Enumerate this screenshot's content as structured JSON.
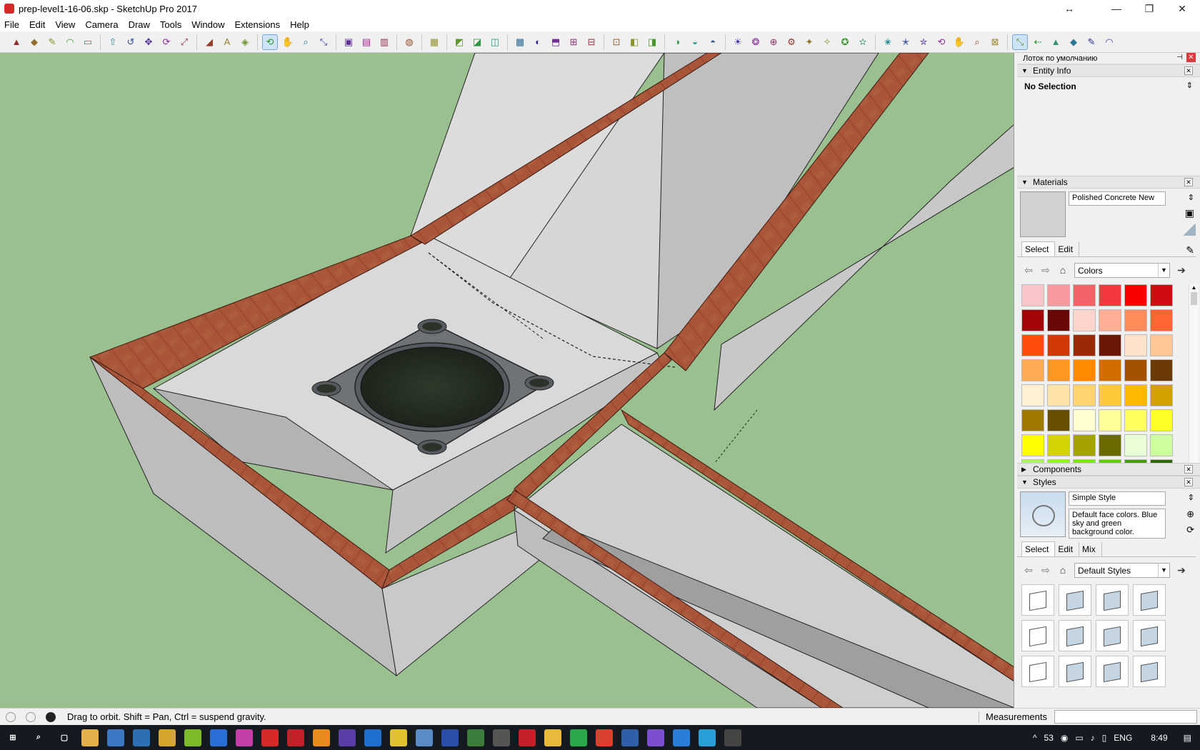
{
  "window": {
    "title": "prep-level1-16-06.skp - SketchUp Pro 2017",
    "controls": [
      "↔",
      "—",
      "❐",
      "✕"
    ]
  },
  "menu": [
    "File",
    "Edit",
    "View",
    "Camera",
    "Draw",
    "Tools",
    "Window",
    "Extensions",
    "Help"
  ],
  "toolbar": {
    "groups": [
      [
        "select-tool",
        "eraser-tool",
        "pencil-tool",
        "arc-tool",
        "rectangle-tool"
      ],
      [
        "push-pull-tool",
        "follow-me-tool",
        "move-tool",
        "rotate-tool",
        "scale-tool"
      ],
      [
        "tape-measure-tool",
        "text-tool",
        "paint-bucket-tool"
      ],
      [
        "orbit-tool",
        "pan-tool",
        "zoom-tool",
        "zoom-extents-tool"
      ],
      [
        "warehouse-tool",
        "share-component-tool",
        "share-model-tool"
      ],
      [
        "extension-warehouse-tool"
      ],
      [
        "layout-tool"
      ],
      [
        "sandbox-1-tool",
        "sandbox-2-tool",
        "sandbox-3-tool"
      ],
      [
        "section-plane-tool",
        "section-display-tool",
        "section-fill-tool",
        "section-cut-tool",
        "position-camera-tool"
      ],
      [
        "xray-tool",
        "back-edges-tool",
        "wireframe-tool"
      ],
      [
        "hidden-line-tool",
        "shaded-tool",
        "textured-tool"
      ],
      [
        "walk-tool",
        "look-around-tool",
        "shadows-tool",
        "fog-tool",
        "match-photo-tool",
        "sun-tool",
        "globe-tool",
        "settings-tool"
      ],
      [
        "export-1-tool",
        "export-2-tool",
        "export-3-tool",
        "export-4-tool",
        "export-5-tool",
        "export-6-tool",
        "export-7-tool"
      ],
      [
        "orbit-2-tool",
        "pan-2-tool",
        "zoom-2-tool",
        "zoom-window-tool",
        "zoom-extents-2-tool",
        "previous-view-tool"
      ]
    ]
  },
  "tray": {
    "title": "Лоток по умолчанию",
    "entity_info": {
      "header": "Entity Info",
      "selection": "No Selection"
    },
    "materials": {
      "header": "Materials",
      "name": "Polished Concrete New",
      "tabs": [
        "Select",
        "Edit"
      ],
      "library": "Colors",
      "swatches": [
        "#f8c6c9",
        "#f79a9f",
        "#f36266",
        "#f43840",
        "#fc0000",
        "#d00b11",
        "#a10508",
        "#680608",
        "#ffd4cc",
        "#ffad94",
        "#ff8c5a",
        "#ff6433",
        "#ff4d0f",
        "#d23a05",
        "#9a2a05",
        "#6a1a04",
        "#ffe2cc",
        "#ffc797",
        "#ffaa55",
        "#ff9722",
        "#ff8a00",
        "#d26e00",
        "#a35300",
        "#6c3a07",
        "#fff2d3",
        "#ffe2a8",
        "#ffd470",
        "#ffc838",
        "#ffba00",
        "#d4a000",
        "#a07a00",
        "#684f00",
        "#ffffd2",
        "#ffff9b",
        "#ffff60",
        "#ffff25",
        "#ffff00",
        "#d4d200",
        "#a3a200",
        "#6b6a00",
        "#eaffd6",
        "#ccff9e",
        "#a6ff4f",
        "#8cff1e",
        "#70f000",
        "#5bd000",
        "#419d00",
        "#2a6a00"
      ]
    },
    "components": {
      "header": "Components"
    },
    "styles": {
      "header": "Styles",
      "name": "Simple Style",
      "description": "Default face colors. Blue sky and green background color.",
      "tabs": [
        "Select",
        "Edit",
        "Mix"
      ],
      "library": "Default Styles"
    }
  },
  "status": {
    "hint": "Drag to orbit. Shift = Pan, Ctrl = suspend gravity.",
    "measurements_label": "Measurements",
    "measurements_value": ""
  },
  "taskbar": {
    "apps": [
      "start",
      "search",
      "task-view",
      "explorer",
      "app-gear",
      "app-monitor",
      "app-hand",
      "app-green",
      "photoshop",
      "xd",
      "sketchup",
      "sketchup-2",
      "blender",
      "app-circle",
      "app-circle-2",
      "app-tree",
      "app-virus",
      "app-shield",
      "app-chart",
      "app-ball",
      "filezilla",
      "chrome",
      "app-chat",
      "app-mail",
      "app-news",
      "viber",
      "app-windows",
      "app-box",
      "app-zip"
    ],
    "tray": {
      "up_arrow": "^",
      "num": "53",
      "lang": "ENG",
      "time": "8:49"
    }
  },
  "colors": {
    "sky_ground": "#9ac08f",
    "concrete": "#d4d4d4",
    "brick": "#9a4a32"
  }
}
